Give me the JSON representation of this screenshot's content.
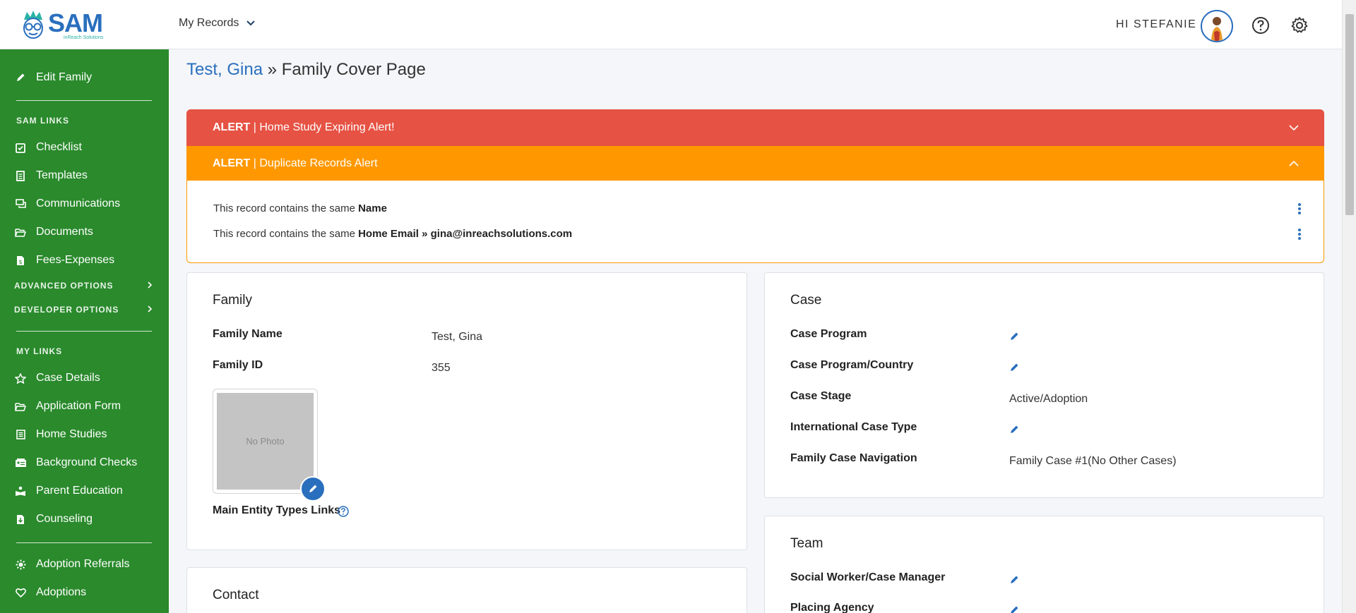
{
  "header": {
    "logo_text": "SAM",
    "logo_subtext": "inReach Solutions",
    "records_menu": "My Records",
    "greeting": "HI STEFANIE"
  },
  "sidebar": {
    "edit_family": "Edit Family",
    "sam_links_heading": "SAM LINKS",
    "sam_links": [
      "Checklist",
      "Templates",
      "Communications",
      "Documents",
      "Fees-Expenses"
    ],
    "advanced_options": "ADVANCED OPTIONS",
    "developer_options": "DEVELOPER OPTIONS",
    "my_links_heading": "MY LINKS",
    "my_links": [
      "Case Details",
      "Application Form",
      "Home Studies",
      "Background Checks",
      "Parent Education",
      "Counseling"
    ],
    "extra_links": [
      "Adoption Referrals",
      "Adoptions"
    ]
  },
  "page": {
    "title_link": "Test, Gina",
    "title_sep": " » ",
    "title_rest": "Family Cover Page"
  },
  "alerts": {
    "home_study": {
      "tag": "ALERT",
      "text": " | Home Study Expiring Alert!"
    },
    "duplicate": {
      "tag": "ALERT",
      "text": " | Duplicate Records Alert"
    },
    "duplicate_rows": [
      {
        "prefix": "This record contains the same ",
        "field": "Name",
        "detail": ""
      },
      {
        "prefix": "This record contains the same ",
        "field": "Home Email",
        "detail": " » gina@inreachsolutions.com"
      }
    ]
  },
  "family_card": {
    "title": "Family",
    "family_name_label": "Family Name",
    "family_name_value": "Test, Gina",
    "family_id_label": "Family ID",
    "family_id_value": "355",
    "photo_placeholder": "No Photo",
    "entity_links_label": "Main Entity Types Links"
  },
  "case_card": {
    "title": "Case",
    "case_program_label": "Case Program",
    "case_program_country_label": "Case Program/Country",
    "case_stage_label": "Case Stage",
    "case_stage_value": "Active/Adoption",
    "intl_case_type_label": "International Case Type",
    "family_case_nav_label": "Family Case Navigation",
    "family_case_nav_value": "Family Case #1(No Other Cases)"
  },
  "contact_card": {
    "title": "Contact"
  },
  "team_card": {
    "title": "Team",
    "social_worker_label": "Social Worker/Case Manager",
    "placing_agency_label": "Placing Agency"
  },
  "colors": {
    "sidebar": "#2a8a2c",
    "accent": "#2a6fbe",
    "alert_red": "#e65243",
    "alert_orange": "#ff9800"
  }
}
